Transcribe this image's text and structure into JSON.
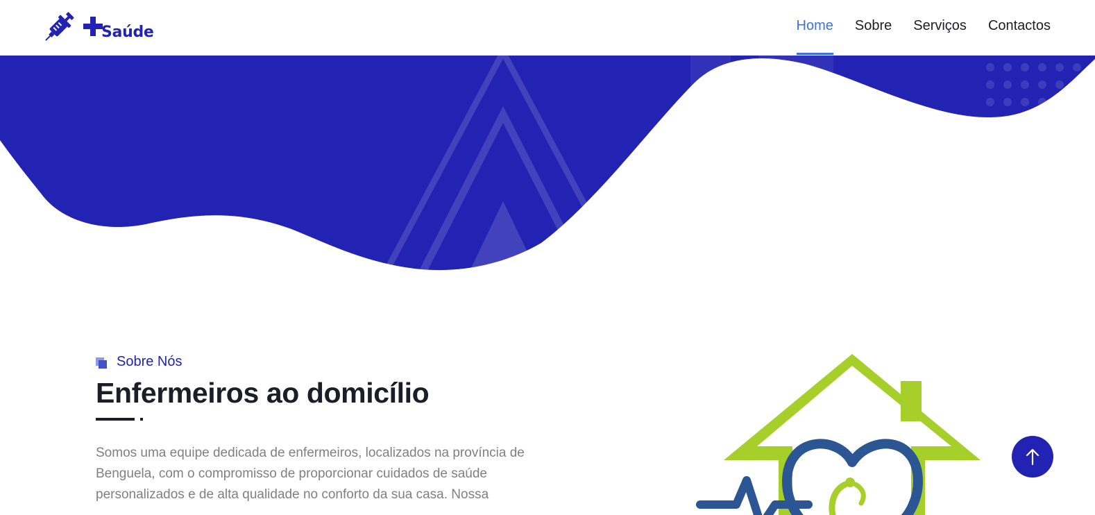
{
  "header": {
    "logo_text": "Saúde",
    "nav": [
      {
        "label": "Home",
        "active": true
      },
      {
        "label": "Sobre",
        "active": false
      },
      {
        "label": "Serviços",
        "active": false
      },
      {
        "label": "Contactos",
        "active": false
      }
    ]
  },
  "about": {
    "eyebrow": "Sobre Nós",
    "title": "Enfermeiros ao domicílio",
    "body": "Somos uma equipe dedicada de enfermeiros, localizados na província de Benguela, com o compromisso de proporcionar cuidados de saúde personalizados e de alta qualidade no conforto da sua casa. Nossa"
  },
  "icons": {
    "logo": "syringe-icon",
    "logo_plus": "plus-icon",
    "eyebrow": "squares-icon",
    "back_to_top": "arrow-up-icon",
    "illustration": "home-care-heart-logo"
  },
  "colors": {
    "brand": "#2323b3",
    "nav_active": "#3d6fe6",
    "text": "#1d1d27",
    "muted": "#808080",
    "green": "#a6cf2a",
    "navy": "#2b5693"
  }
}
